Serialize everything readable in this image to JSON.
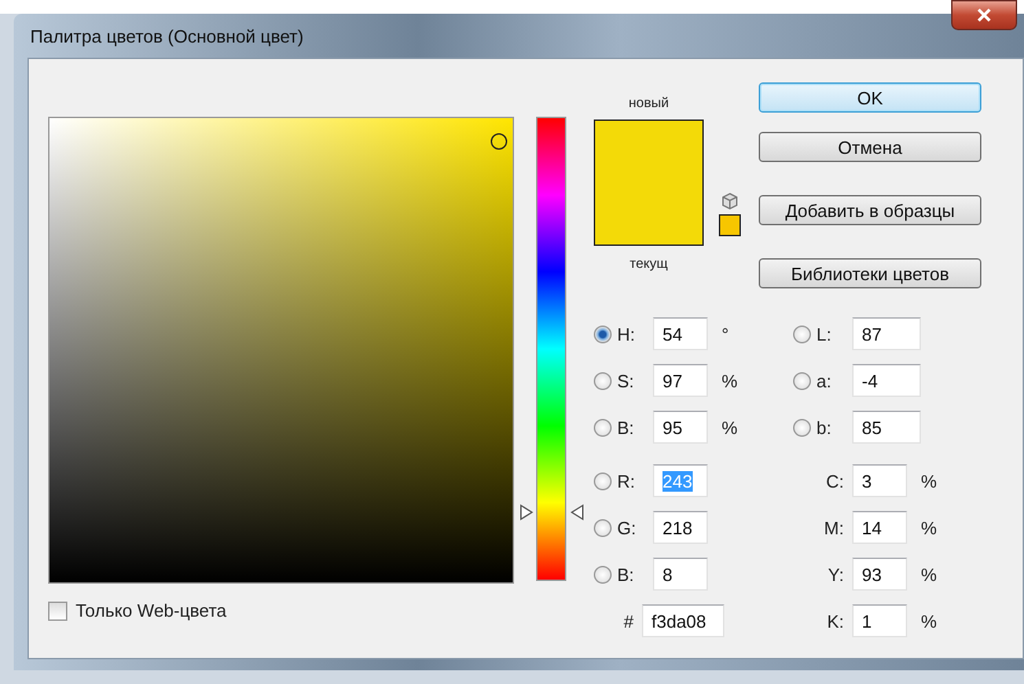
{
  "window": {
    "title": "Палитра цветов (Основной цвет)"
  },
  "hue_slider": {
    "level": 0.15
  },
  "swatches": {
    "new_label": "новый",
    "current_label": "текущ",
    "out_of_gamut": true
  },
  "buttons": [
    {
      "label": "OK",
      "default": true
    },
    {
      "label": "Отмена",
      "default": false
    },
    {
      "label": "Добавить в образцы",
      "default": false
    },
    {
      "label": "Библиотеки цветов",
      "default": false
    }
  ],
  "hsb_rgb_fields": [
    {
      "kind": "radio",
      "label": "H:",
      "value": "54",
      "unit": "°",
      "selected": true,
      "highlighted": false
    },
    {
      "kind": "radio",
      "label": "S:",
      "value": "97",
      "unit": "%",
      "selected": false,
      "highlighted": false
    },
    {
      "kind": "radio",
      "label": "B:",
      "value": "95",
      "unit": "%",
      "selected": false,
      "highlighted": false
    },
    {
      "kind": "radio",
      "label": "R:",
      "value": "243",
      "selected": false,
      "highlighted": true
    },
    {
      "kind": "radio",
      "label": "G:",
      "value": "218",
      "selected": false,
      "highlighted": false
    },
    {
      "kind": "radio",
      "label": "B:",
      "value": "8",
      "selected": false,
      "highlighted": false
    }
  ],
  "hex_field": {
    "label": "#",
    "value": "f3da08"
  },
  "lab_cmyk_fields": [
    {
      "kind": "radio",
      "label": "L:",
      "value": "87",
      "selected": false
    },
    {
      "kind": "radio",
      "label": "a:",
      "value": "-4",
      "selected": false
    },
    {
      "kind": "radio",
      "label": "b:",
      "value": "85",
      "selected": false
    },
    {
      "kind": "plain",
      "label": "C:",
      "value": "3",
      "unit": "%"
    },
    {
      "kind": "plain",
      "label": "M:",
      "value": "14",
      "unit": "%"
    },
    {
      "kind": "plain",
      "label": "Y:",
      "value": "93",
      "unit": "%"
    },
    {
      "kind": "plain",
      "label": "K:",
      "value": "1",
      "unit": "%"
    }
  ],
  "web_colors_only": {
    "label": "Только Web-цвета",
    "checked": false
  }
}
